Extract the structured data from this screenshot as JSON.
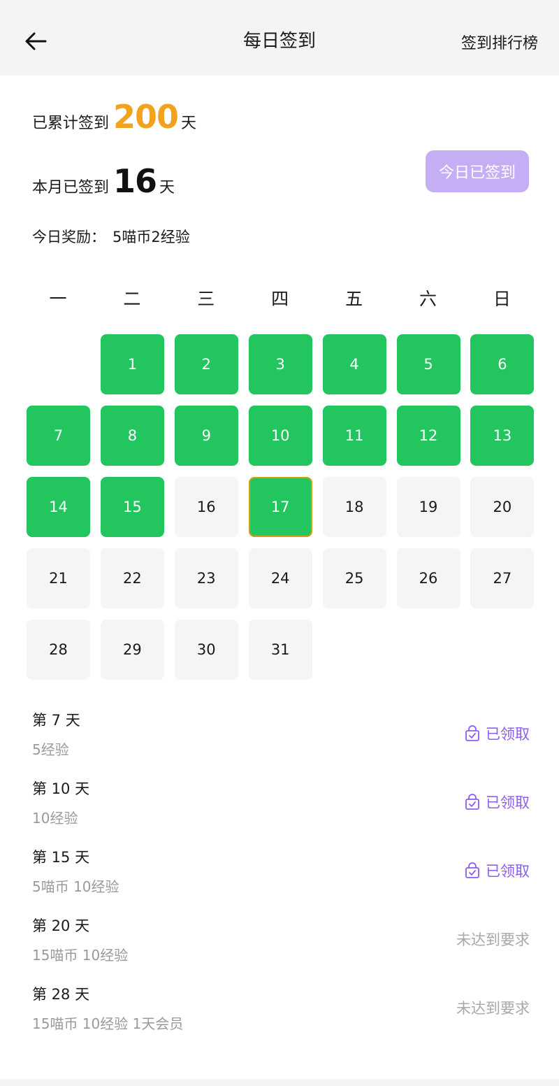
{
  "header": {
    "title": "每日签到",
    "rank_link": "签到排行榜",
    "back_icon": "arrow-left-icon"
  },
  "stats": {
    "total_label": "已累计签到",
    "total_days": "200",
    "total_unit": "天",
    "month_label": "本月已签到",
    "month_days": "16",
    "month_unit": "天",
    "reward_label": "今日奖励：",
    "reward_value": "5喵币2经验",
    "signed_button": "今日已签到"
  },
  "colors": {
    "accent_orange": "#f2a31b",
    "signed_green": "#22c55e",
    "button_purple": "#c6aef5",
    "claimed_purple": "#8b5cf6",
    "today_border": "#d4a017"
  },
  "calendar": {
    "weekdays": [
      "一",
      "二",
      "三",
      "四",
      "五",
      "六",
      "日"
    ],
    "first_weekday_index": 1,
    "today": 17,
    "signed_days": [
      1,
      2,
      3,
      4,
      5,
      6,
      7,
      8,
      9,
      10,
      11,
      12,
      13,
      14,
      15,
      17
    ],
    "days": [
      "1",
      "2",
      "3",
      "4",
      "5",
      "6",
      "7",
      "8",
      "9",
      "10",
      "11",
      "12",
      "13",
      "14",
      "15",
      "16",
      "17",
      "18",
      "19",
      "20",
      "21",
      "22",
      "23",
      "24",
      "25",
      "26",
      "27",
      "28",
      "29",
      "30",
      "31"
    ]
  },
  "rewards": [
    {
      "title": "第 7 天",
      "desc": "5经验",
      "status": "已领取",
      "claimed": true,
      "icon": "gift-bag-check-icon"
    },
    {
      "title": "第 10 天",
      "desc": "10经验",
      "status": "已领取",
      "claimed": true,
      "icon": "gift-bag-check-icon"
    },
    {
      "title": "第 15 天",
      "desc": "5喵币 10经验",
      "status": "已领取",
      "claimed": true,
      "icon": "gift-bag-check-icon"
    },
    {
      "title": "第 20 天",
      "desc": "15喵币 10经验",
      "status": "未达到要求",
      "claimed": false
    },
    {
      "title": "第 28 天",
      "desc": "15喵币 10经验 1天会员",
      "status": "未达到要求",
      "claimed": false
    }
  ]
}
